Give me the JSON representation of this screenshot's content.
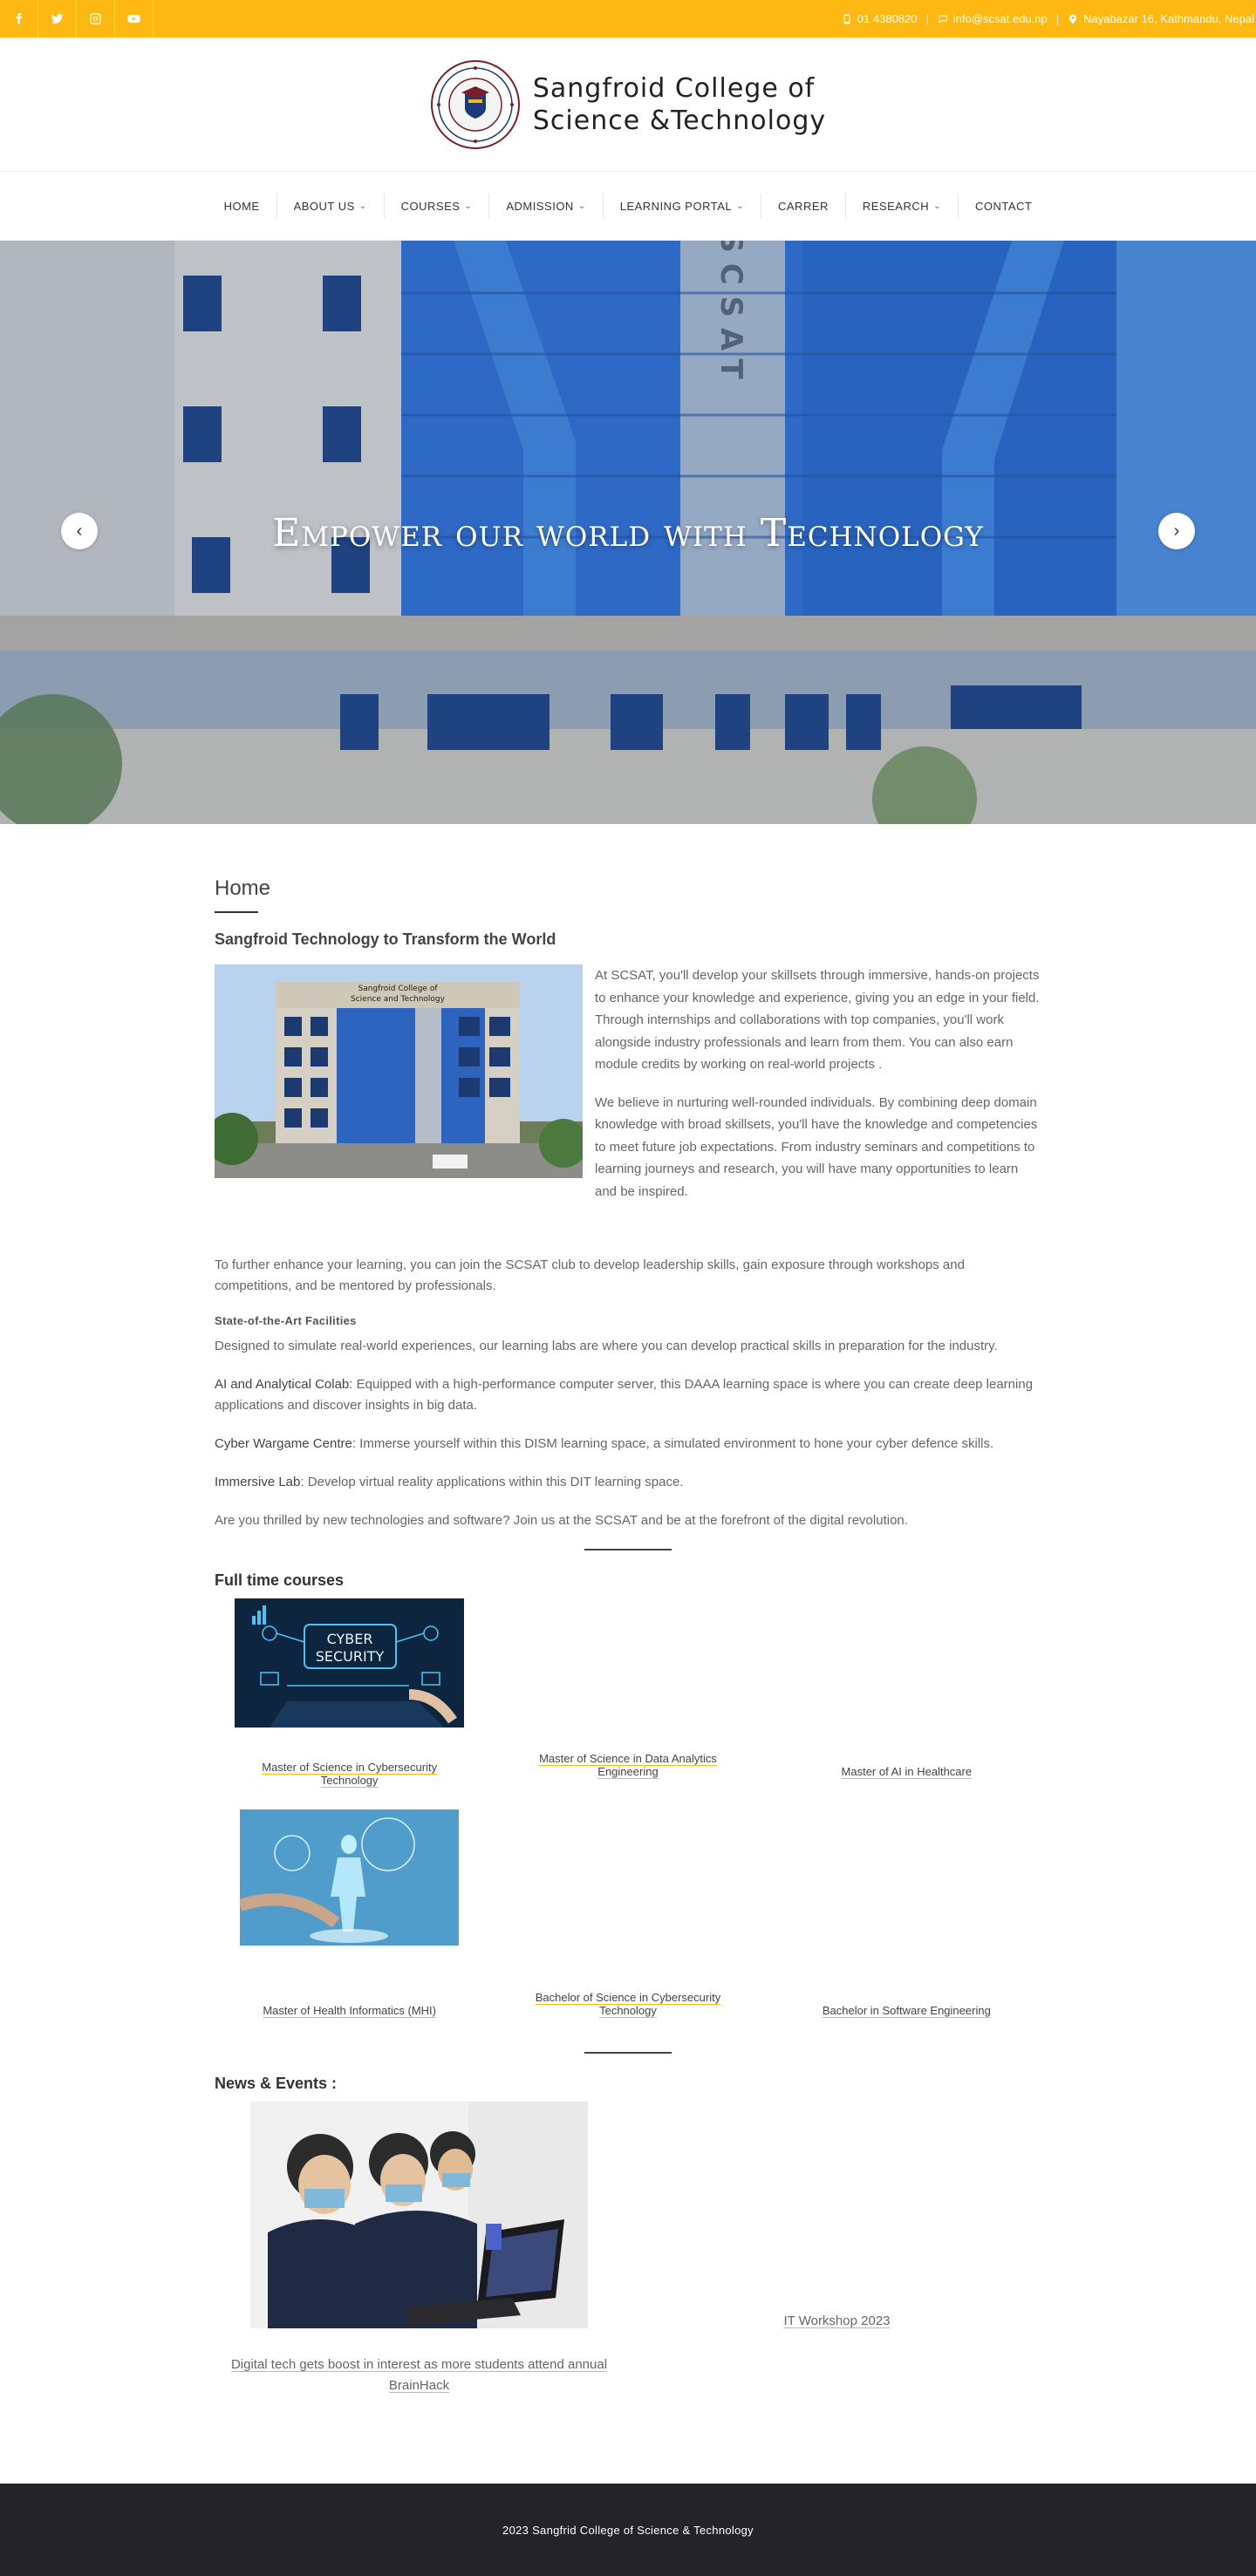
{
  "topbar": {
    "socials": [
      "facebook-icon",
      "twitter-icon",
      "instagram-icon",
      "youtube-icon"
    ],
    "phone": "01 4380820",
    "email": "info@scsat.edu.np",
    "address": "Nayabazar 16, Kathmandu, Nepal",
    "accent": "#fdb813"
  },
  "brand": {
    "name_line1": "Sangfroid College of",
    "name_line2": "Science &Technology"
  },
  "nav": {
    "items": [
      {
        "label": "HOME",
        "dropdown": false
      },
      {
        "label": "ABOUT US",
        "dropdown": true
      },
      {
        "label": "COURSES",
        "dropdown": true
      },
      {
        "label": "ADMISSION",
        "dropdown": true
      },
      {
        "label": "LEARNING PORTAL",
        "dropdown": true
      },
      {
        "label": "CARRER",
        "dropdown": false
      },
      {
        "label": "RESEARCH",
        "dropdown": true
      },
      {
        "label": "CONTACT",
        "dropdown": false
      }
    ]
  },
  "hero": {
    "caption": "Empower our world with Technology",
    "building_sign": "SCSAT"
  },
  "main": {
    "title": "Home",
    "subtitle": "Sangfroid Technology to Transform the World",
    "photo_sign_line1": "Sangfroid College of",
    "photo_sign_line2": "Science and Technology",
    "intro_p1": "At SCSAT, you'll develop your skillsets through immersive, hands-on projects to enhance your knowledge and experience, giving you an edge in your field. Through internships and collaborations with top companies, you'll work alongside industry professionals and learn from them. You can also earn module credits by working on real-world projects .",
    "intro_p2": "We believe in nurturing well-rounded individuals. By combining deep domain knowledge with broad skillsets, you'll have the knowledge and competencies to meet future job expectations. From industry seminars and competitions to learning journeys and research, you will have many opportunities to learn and be inspired.",
    "p3": "To further enhance your learning, you can join the SCSAT club to develop leadership skills, gain exposure through workshops and competitions, and be mentored by professionals.",
    "facilities_head": "State-of-the-Art Facilities",
    "facilities_p": "Designed to simulate real-world experiences, our learning labs are where you can develop practical skills in preparation for the industry.",
    "ai_name": "AI and Analytical Colab",
    "ai_desc": ": Equipped with a high-performance computer server, this DAAA learning space is where you can create deep learning applications and discover insights in big data.",
    "cyber_name": "Cyber Wargame Centre",
    "cyber_desc": ": Immerse yourself within this DISM learning space, a simulated environment to hone your cyber defence skills.",
    "imm_name": "Immersive Lab",
    "imm_desc": ": Develop virtual reality applications within this DIT learning space.",
    "closing": "Are you thrilled by new technologies and software? Join us at the SCSAT and be at the forefront of the digital revolution."
  },
  "courses": {
    "heading": "Full time courses",
    "cyber_img_text1": "CYBER",
    "cyber_img_text2": "SECURITY",
    "items": [
      {
        "label": "Master of Science in Cybersecurity Technology"
      },
      {
        "label": "Master of Science in Data Analytics Engineering"
      },
      {
        "label": "Master of AI in Healthcare"
      },
      {
        "label": "Master of Health Informatics (MHI)"
      },
      {
        "label": "Bachelor of Science in Cybersecurity Technology"
      },
      {
        "label": "Bachelor in Software Engineering"
      }
    ]
  },
  "news": {
    "heading": "News & Events :",
    "items": [
      {
        "label": "Digital tech gets boost in interest as more students attend annual BrainHack"
      },
      {
        "label": "IT Workshop 2023"
      }
    ]
  },
  "footer": {
    "text": "2023 Sangfrid College of Science & Technology"
  }
}
